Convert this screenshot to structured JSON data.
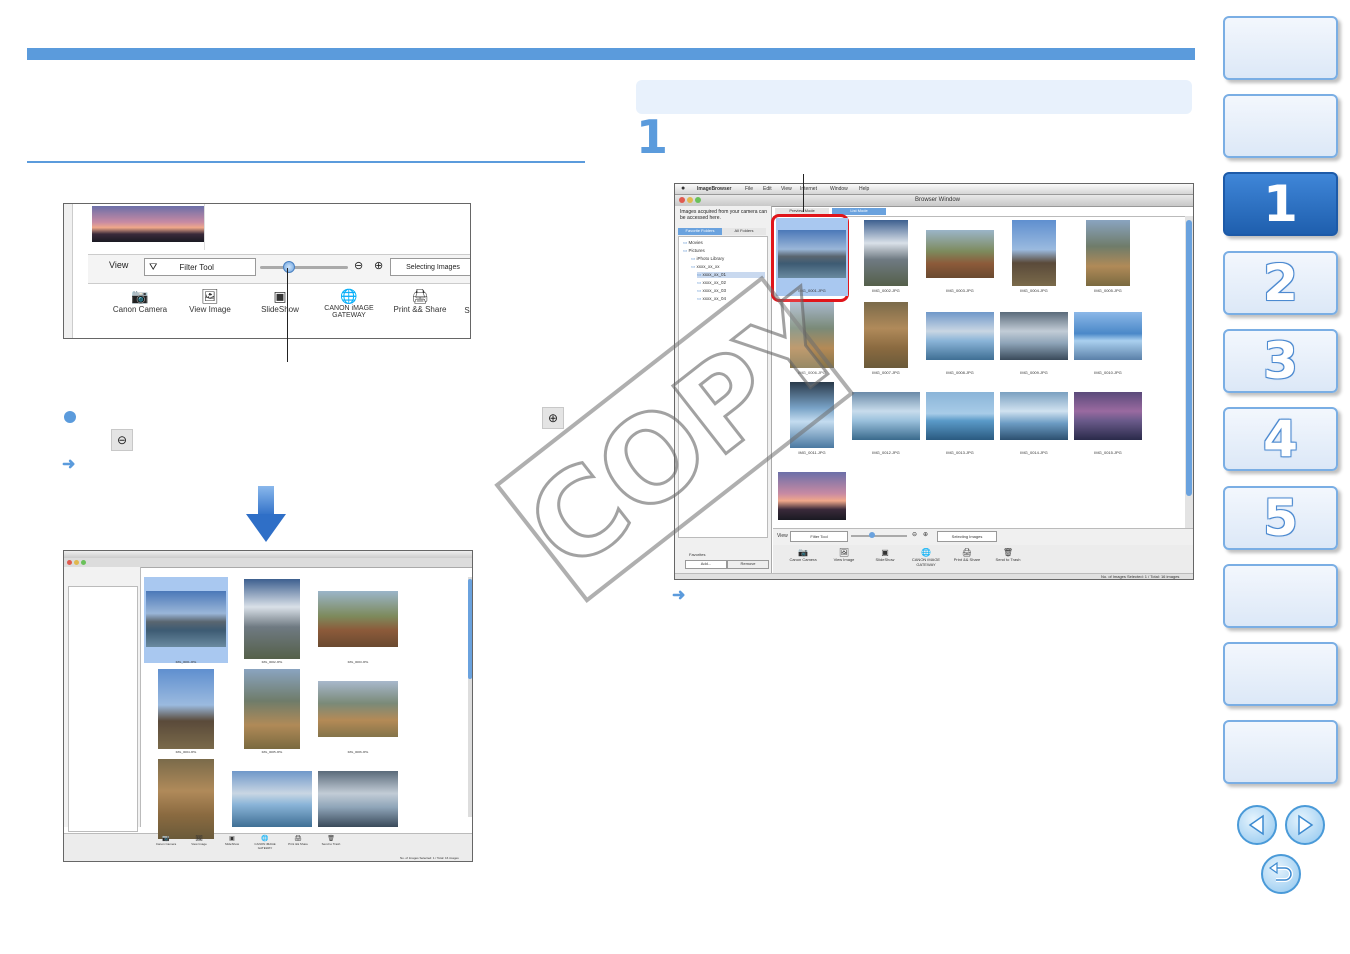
{
  "nav": {
    "tabs": [
      {
        "label": ""
      },
      {
        "label": ""
      },
      {
        "label": "1"
      },
      {
        "label": "2"
      },
      {
        "label": "3"
      },
      {
        "label": "4"
      },
      {
        "label": "5"
      },
      {
        "label": ""
      },
      {
        "label": ""
      },
      {
        "label": ""
      }
    ],
    "active_tab": "1"
  },
  "step": {
    "number": "1"
  },
  "watermark": {
    "text": "COPY"
  },
  "zoom_shot": {
    "view_label": "View",
    "filter_tool": "Filter Tool",
    "selecting_images": "Selecting Images",
    "tools": [
      {
        "label": "Canon Camera",
        "icon": "camera-icon"
      },
      {
        "label": "View Image",
        "icon": "image-icon"
      },
      {
        "label": "SlideShow",
        "icon": "slideshow-icon"
      },
      {
        "label": "CANON iMAGE GATEWAY",
        "icon": "globe-icon"
      },
      {
        "label": "Print && Share",
        "icon": "printer-icon"
      },
      {
        "label": "S",
        "icon": ""
      }
    ]
  },
  "browser": {
    "menu": [
      "ImageBrowser",
      "File",
      "Edit",
      "View",
      "Internet",
      "Window",
      "Help"
    ],
    "window_title": "Browser Window",
    "side_caption": "Images acquired from your camera can be accessed here.",
    "panel_tabs": [
      "Favorite Folders",
      "All Folders"
    ],
    "mode_tabs": [
      "Preview Mode",
      "List Mode"
    ],
    "tree": [
      "Movies",
      "Pictures",
      "iPhoto Library",
      "xxxx_xx_xx",
      "xxxx_xx_01",
      "xxxx_xx_02",
      "xxxx_xx_03",
      "xxxx_xx_04"
    ],
    "favorites_label": "Favorites",
    "add_button": "Add...",
    "remove_button": "Remove",
    "view_label": "View",
    "filter_tool": "Filter Tool",
    "selecting_images": "Selecting Images",
    "tools": [
      "Canon Camera",
      "View Image",
      "SlideShow",
      "CANON iMAGE GATEWAY",
      "Print && Share",
      "Send to Trash"
    ],
    "status": "No. of Images Selected: 1 / Total: 16 images",
    "images": [
      "IMG_0001.JPG",
      "IMG_0002.JPG",
      "IMG_0003.JPG",
      "IMG_0004.JPG",
      "IMG_0005.JPG",
      "IMG_0006.JPG",
      "IMG_0007.JPG",
      "IMG_0008.JPG",
      "IMG_0009.JPG",
      "IMG_0010.JPG",
      "IMG_0011.JPG",
      "IMG_0012.JPG",
      "IMG_0013.JPG",
      "IMG_0014.JPG",
      "IMG_0015.JPG",
      ""
    ]
  },
  "small_browser": {
    "images": [
      "IMG_0001.JPG",
      "IMG_0002.JPG",
      "IMG_0003.JPG",
      "IMG_0004.JPG",
      "IMG_0005.JPG",
      "IMG_0006.JPG",
      "",
      "",
      ""
    ],
    "tools": [
      "Canon Camera",
      "View Image",
      "SlideShow",
      "CANON iMAGE GATEWAY",
      "Print && Share",
      "Send to Trash"
    ],
    "status": "No. of Images Selected: 1 / Total: 16 images"
  },
  "colors": {
    "accent": "#5b9bdc",
    "highlight": "#e8f1fc",
    "selection_red": "#e0151b",
    "active_tab": "#2a6fc2"
  }
}
